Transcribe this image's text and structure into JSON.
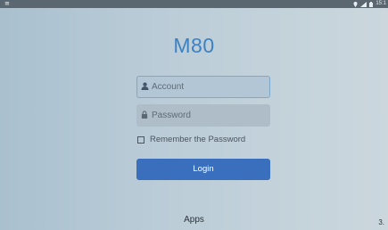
{
  "status_bar": {
    "left_icon": "notification-icon",
    "right_icons": [
      "location-icon",
      "signal-icon",
      "battery-icon"
    ],
    "time": "15:1"
  },
  "app_title": "M80",
  "account": {
    "placeholder": "Account",
    "icon": "person-icon"
  },
  "password": {
    "placeholder": "Password",
    "icon": "lock-icon"
  },
  "remember": {
    "label": "Remember the Password",
    "checked": false
  },
  "login_label": "Login",
  "apps_label": "Apps",
  "corner_text": "3.",
  "colors": {
    "accent": "#3b82c4",
    "button": "#3a6fbd"
  }
}
